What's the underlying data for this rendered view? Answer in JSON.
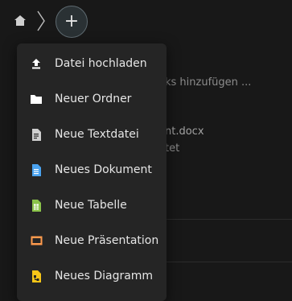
{
  "header": {
    "home_icon": "home-icon",
    "add_label": "+"
  },
  "background": {
    "hint_text": "ks hinzufügen ...",
    "file_name": "nt.docx",
    "file_status": "tet"
  },
  "menu": {
    "items": [
      {
        "label": "Datei hochladen",
        "icon": "upload-icon",
        "color": "#ffffff"
      },
      {
        "label": "Neuer Ordner",
        "icon": "folder-icon",
        "color": "#ffffff"
      },
      {
        "label": "Neue Textdatei",
        "icon": "text-file-icon",
        "color": "#cfcfcf"
      },
      {
        "label": "Neues Dokument",
        "icon": "document-icon",
        "color": "#4aa3f0"
      },
      {
        "label": "Neue Tabelle",
        "icon": "spreadsheet-icon",
        "color": "#8bc34a"
      },
      {
        "label": "Neue Präsentation",
        "icon": "presentation-icon",
        "color": "#ff9a4d"
      },
      {
        "label": "Neues Diagramm",
        "icon": "diagram-icon",
        "color": "#f5c518"
      }
    ]
  }
}
